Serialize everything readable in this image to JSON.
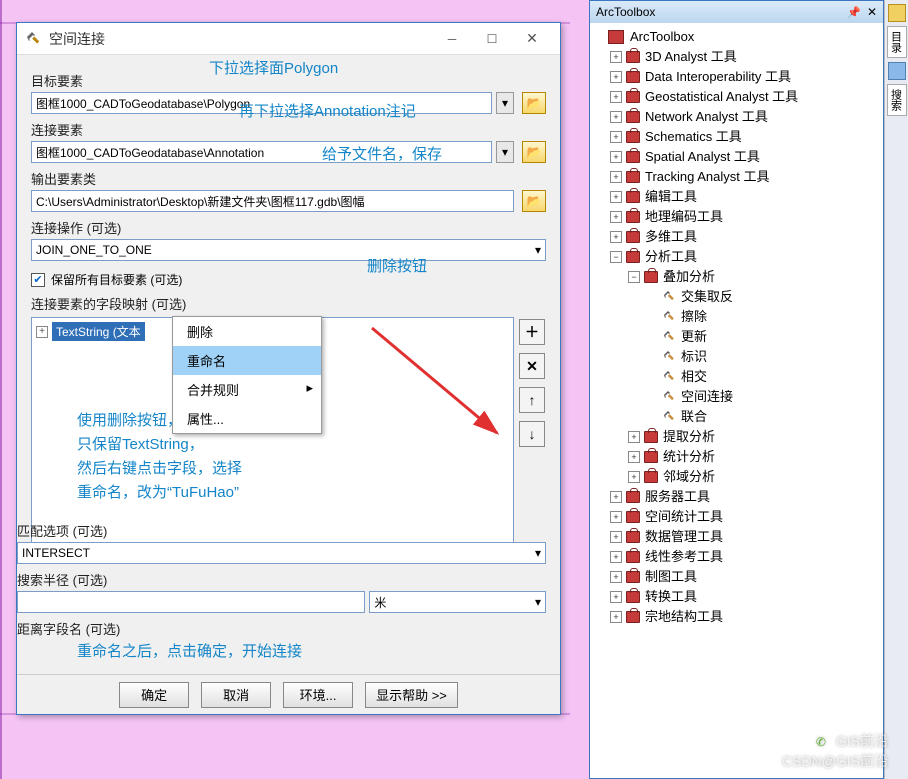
{
  "dialog": {
    "title": "空间连接",
    "target_label": "目标要素",
    "target_value": "图框1000_CADToGeodatabase\\Polygon",
    "join_label": "连接要素",
    "join_value": "图框1000_CADToGeodatabase\\Annotation",
    "output_label": "输出要素类",
    "output_value": "C:\\Users\\Administrator\\Desktop\\新建文件夹\\图框117.gdb\\图幅",
    "join_op_label": "连接操作 (可选)",
    "join_op_value": "JOIN_ONE_TO_ONE",
    "keep_all_label": "保留所有目标要素 (可选)",
    "fieldmap_label": "连接要素的字段映射 (可选)",
    "tree_item": "TextString (文本",
    "match_label": "匹配选项 (可选)",
    "match_value": "INTERSECT",
    "radius_label": "搜索半径 (可选)",
    "radius_unit": "米",
    "distance_label": "距离字段名 (可选)",
    "ok": "确定",
    "cancel": "取消",
    "env": "环境...",
    "help": "显示帮助 >>"
  },
  "ctxmenu": {
    "delete": "删除",
    "rename": "重命名",
    "merge": "合并规则",
    "props": "属性..."
  },
  "annotations": {
    "a1": "下拉选择面Polygon",
    "a2": "再下拉选择Annotation注记",
    "a3": "给予文件名，保存",
    "a4": "删除按钮",
    "help1": "使用删除按钮，删除多余字段，",
    "help2": "只保留TextString，",
    "help3": "然后右键点击字段，选择",
    "help4": "重命名，改为“TuFuHao”",
    "bottom": "重命名之后，点击确定，开始连接"
  },
  "arctoolbox": {
    "title": "ArcToolbox",
    "root": "ArcToolbox",
    "l1": [
      "3D Analyst 工具",
      "Data Interoperability 工具",
      "Geostatistical Analyst 工具",
      "Network Analyst 工具",
      "Schematics 工具",
      "Spatial Analyst 工具",
      "Tracking Analyst 工具",
      "编辑工具",
      "地理编码工具",
      "多维工具"
    ],
    "analysis": "分析工具",
    "overlay": "叠加分析",
    "overlay_tools": [
      "交集取反",
      "擦除",
      "更新",
      "标识",
      "相交",
      "空间连接",
      "联合"
    ],
    "analysis_sub": [
      "提取分析",
      "统计分析",
      "邻域分析"
    ],
    "l1_after": [
      "服务器工具",
      "空间统计工具",
      "数据管理工具",
      "线性参考工具",
      "制图工具",
      "转换工具",
      "宗地结构工具"
    ]
  },
  "sidebar": {
    "tab1": "目录",
    "tab2": "搜索"
  },
  "watermark": {
    "line1": "GIS前沿",
    "line2": "CSDN@GIS前沿"
  }
}
